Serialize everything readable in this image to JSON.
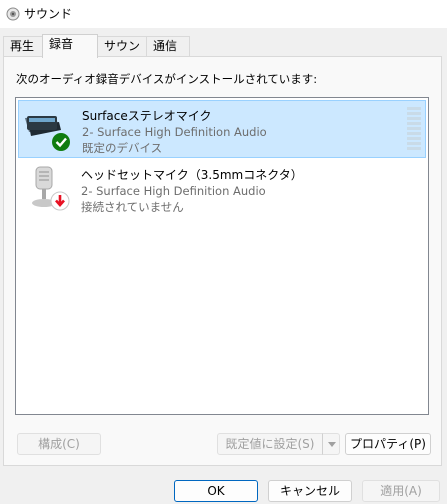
{
  "window": {
    "title": "サウンド",
    "icon": "speaker-icon"
  },
  "tabs": [
    {
      "label": "再生",
      "active": false
    },
    {
      "label": "録音",
      "active": true
    },
    {
      "label": "サウンド",
      "active": false
    },
    {
      "label": "通信",
      "active": false
    }
  ],
  "recording": {
    "instruction": "次のオーディオ録音デバイスがインストールされています:",
    "devices": [
      {
        "name": "Surfaceステレオマイク",
        "line2": "2- Surface High Definition Audio",
        "status": "既定のデバイス",
        "selected": true,
        "icon": "surface-microphone-icon",
        "badge": "default-check-icon"
      },
      {
        "name": "ヘッドセットマイク（3.5mmコネクタ）",
        "line2": "2- Surface High Definition Audio",
        "status": "接続されていません",
        "selected": false,
        "icon": "headset-microphone-icon",
        "badge": "disconnected-arrow-icon"
      }
    ],
    "buttons": {
      "configure": "構成(C)",
      "set_default": "既定値に設定(S)",
      "properties": "プロパティ(P)"
    }
  },
  "dialog_buttons": {
    "ok": "OK",
    "cancel": "キャンセル",
    "apply": "適用(A)"
  },
  "colors": {
    "selection": "#cce8ff",
    "accent": "#0067c0",
    "check": "#107c10",
    "disconnected": "#e81123"
  }
}
